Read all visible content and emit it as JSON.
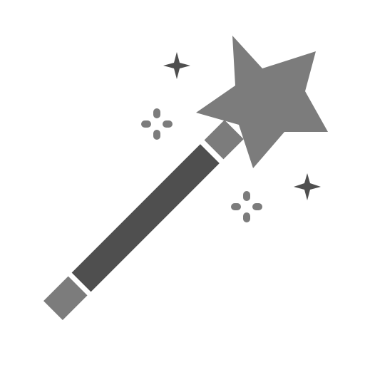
{
  "icon": {
    "name": "magic-wand-icon",
    "colors": {
      "light_gray": "#7c7c7c",
      "dark_gray": "#4f4f4f",
      "background": "#ffffff"
    }
  }
}
